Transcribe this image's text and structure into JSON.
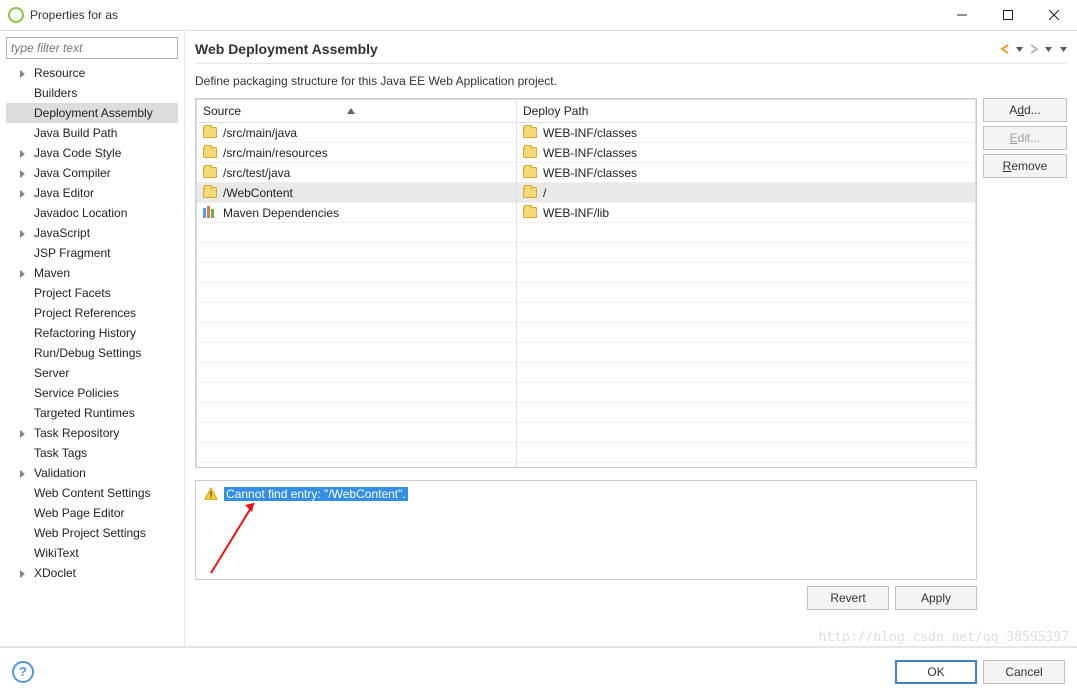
{
  "window": {
    "title": "Properties for as"
  },
  "filter": {
    "placeholder": "type filter text"
  },
  "tree": [
    {
      "label": "Resource",
      "expandable": true
    },
    {
      "label": "Builders",
      "expandable": false
    },
    {
      "label": "Deployment Assembly",
      "expandable": false,
      "selected": true
    },
    {
      "label": "Java Build Path",
      "expandable": false
    },
    {
      "label": "Java Code Style",
      "expandable": true
    },
    {
      "label": "Java Compiler",
      "expandable": true
    },
    {
      "label": "Java Editor",
      "expandable": true
    },
    {
      "label": "Javadoc Location",
      "expandable": false
    },
    {
      "label": "JavaScript",
      "expandable": true
    },
    {
      "label": "JSP Fragment",
      "expandable": false
    },
    {
      "label": "Maven",
      "expandable": true
    },
    {
      "label": "Project Facets",
      "expandable": false
    },
    {
      "label": "Project References",
      "expandable": false
    },
    {
      "label": "Refactoring History",
      "expandable": false
    },
    {
      "label": "Run/Debug Settings",
      "expandable": false
    },
    {
      "label": "Server",
      "expandable": false
    },
    {
      "label": "Service Policies",
      "expandable": false
    },
    {
      "label": "Targeted Runtimes",
      "expandable": false
    },
    {
      "label": "Task Repository",
      "expandable": true
    },
    {
      "label": "Task Tags",
      "expandable": false
    },
    {
      "label": "Validation",
      "expandable": true
    },
    {
      "label": "Web Content Settings",
      "expandable": false
    },
    {
      "label": "Web Page Editor",
      "expandable": false
    },
    {
      "label": "Web Project Settings",
      "expandable": false
    },
    {
      "label": "WikiText",
      "expandable": false
    },
    {
      "label": "XDoclet",
      "expandable": true
    }
  ],
  "content": {
    "heading": "Web Deployment Assembly",
    "description": "Define packaging structure for this Java EE Web Application project.",
    "columns": {
      "source": "Source",
      "deploy": "Deploy Path"
    },
    "rows": [
      {
        "source": "/src/main/java",
        "deploy": "WEB-INF/classes",
        "icon": "folder"
      },
      {
        "source": "/src/main/resources",
        "deploy": "WEB-INF/classes",
        "icon": "folder"
      },
      {
        "source": "/src/test/java",
        "deploy": "WEB-INF/classes",
        "icon": "folder"
      },
      {
        "source": "/WebContent",
        "deploy": "/",
        "icon": "folder",
        "selected": true
      },
      {
        "source": "Maven Dependencies",
        "deploy": "WEB-INF/lib",
        "icon": "lib"
      }
    ],
    "buttons": {
      "add": {
        "pre": "A",
        "u": "d",
        "post": "d..."
      },
      "edit": {
        "pre": "",
        "u": "E",
        "post": "dit...",
        "disabled": true
      },
      "remove": {
        "pre": "",
        "u": "R",
        "post": "emove"
      }
    },
    "warning": "Cannot find entry: \"/WebContent\".",
    "revert_label": "Revert",
    "apply_label": "Apply"
  },
  "footer": {
    "ok": "OK",
    "cancel": "Cancel"
  },
  "watermark": "http://blog.csdn.net/qq_38595397"
}
